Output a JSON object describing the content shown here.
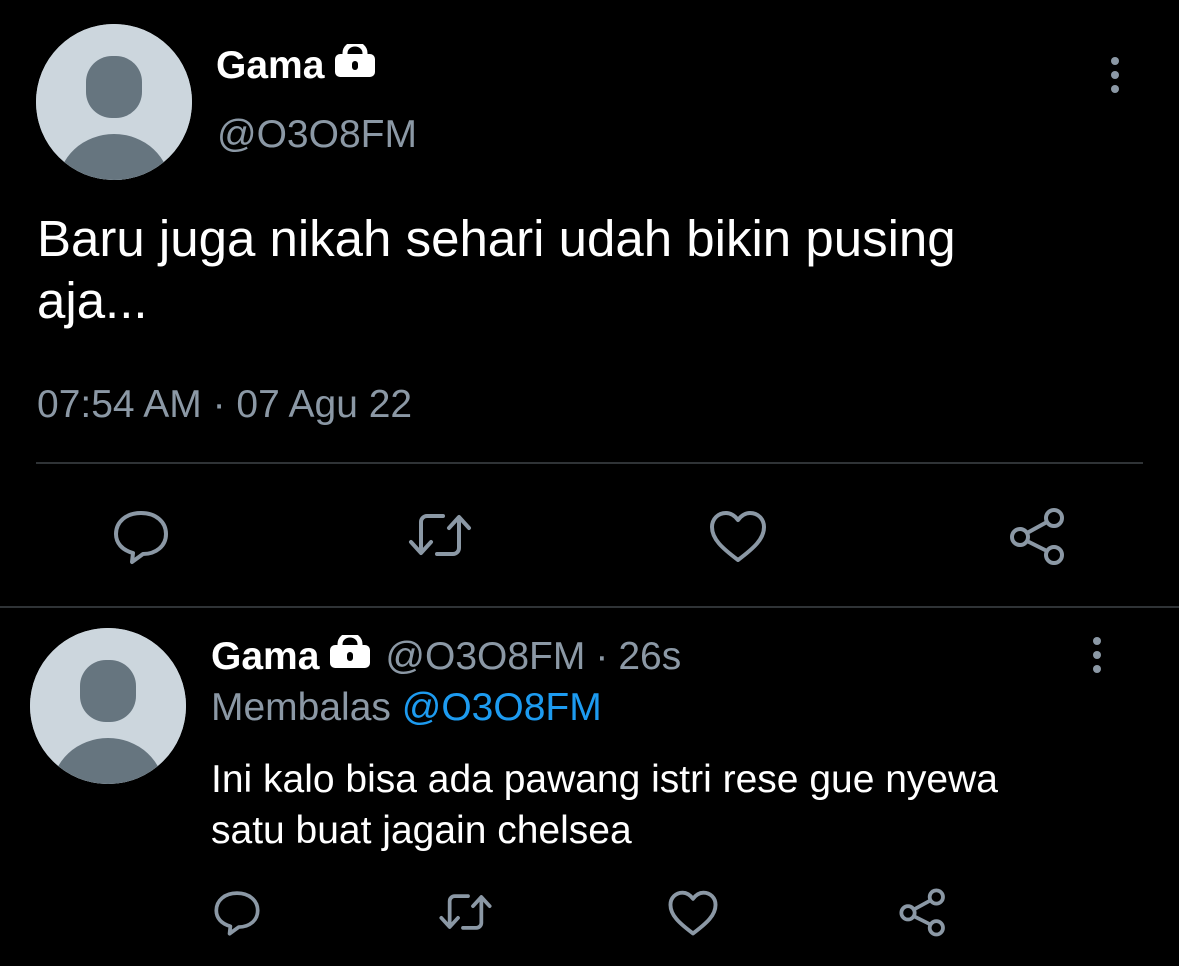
{
  "main_tweet": {
    "author_name": "Gama",
    "handle": "@O3O8FM",
    "text_line1": "Baru juga nikah sehari udah bikin pusing",
    "text_line2": "aja...",
    "timestamp": "07:54 AM · 07 Agu 22"
  },
  "reply": {
    "author_name": "Gama",
    "handle": "@O3O8FM",
    "separator": "·",
    "age": "26s",
    "replying_label": "Membalas",
    "replying_to": "@O3O8FM",
    "text_line1": "Ini kalo bisa ada pawang istri rese gue nyewa",
    "text_line2": "satu buat jagain chelsea"
  },
  "icons": {
    "lock": "lock-icon",
    "more": "more-vertical-icon",
    "reply": "reply-icon",
    "retweet": "retweet-icon",
    "like": "heart-icon",
    "share": "share-icon"
  },
  "colors": {
    "background": "#000000",
    "text": "#ffffff",
    "muted": "#8b98a5",
    "link": "#1d9bf0",
    "divider": "#2f3336",
    "avatar_bg": "#ccd6dd",
    "avatar_fg": "#66757f"
  }
}
